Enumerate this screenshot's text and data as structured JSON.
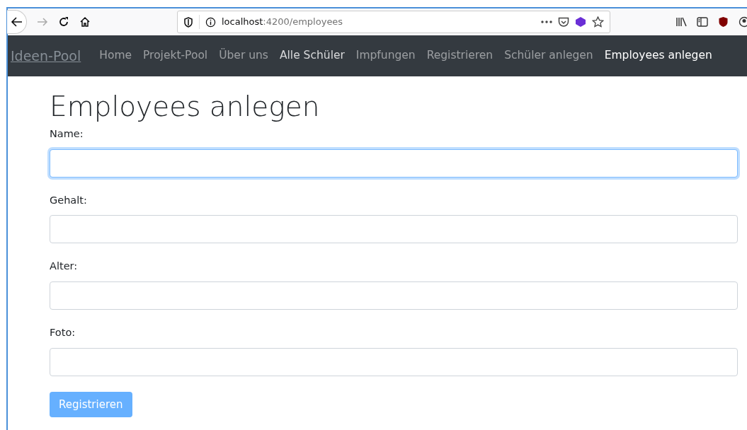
{
  "browser": {
    "url_host": "localhost",
    "url_rest": ":4200/employees",
    "forward_disabled": true
  },
  "navbar": {
    "brand": "Ideen-Pool",
    "items": [
      {
        "label": "Home",
        "selected": false,
        "hovered": false
      },
      {
        "label": "Projekt-Pool",
        "selected": false,
        "hovered": false
      },
      {
        "label": "Über uns",
        "selected": false,
        "hovered": false
      },
      {
        "label": "Alle Schüler",
        "selected": false,
        "hovered": true
      },
      {
        "label": "Impfungen",
        "selected": false,
        "hovered": false
      },
      {
        "label": "Registrieren",
        "selected": false,
        "hovered": false
      },
      {
        "label": "Schüler anlegen",
        "selected": false,
        "hovered": false
      },
      {
        "label": "Employees anlegen",
        "selected": true,
        "hovered": false
      }
    ]
  },
  "form": {
    "title": "Employees anlegen",
    "fields": [
      {
        "label": "Name:",
        "focused": true
      },
      {
        "label": "Gehalt:",
        "focused": false
      },
      {
        "label": "Alter:",
        "focused": false
      },
      {
        "label": "Foto:",
        "focused": false
      }
    ],
    "submit": {
      "label": "Registrieren",
      "disabled": true
    }
  }
}
